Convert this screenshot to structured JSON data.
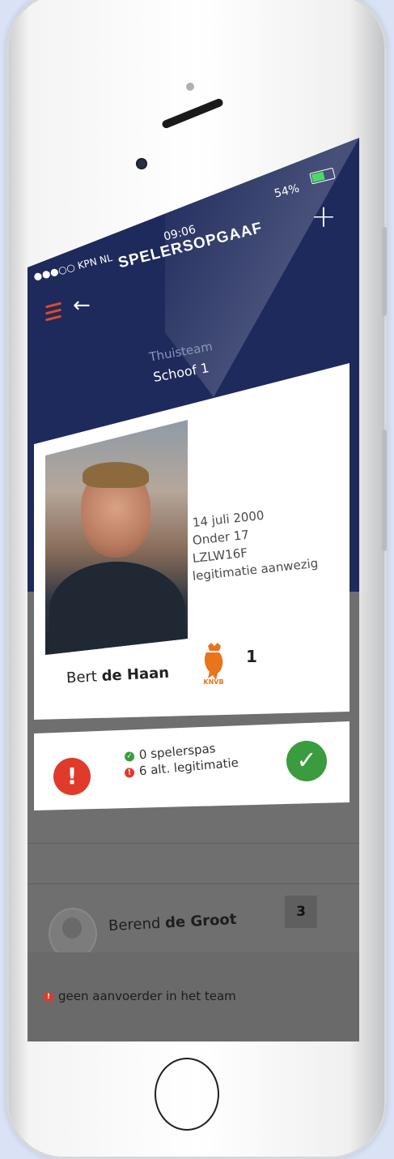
{
  "status_bar": {
    "carrier": "●●●○○ KPN NL",
    "time": "09:06",
    "battery": "54%"
  },
  "header": {
    "title": "SPELERSOPGAAF",
    "home_team_label": "Thuisteam",
    "home_team_name": "Schoof 1"
  },
  "player": {
    "first_name": "Bert",
    "last_name": "de Haan",
    "birth_date": "14 juli 2000",
    "age_group": "Onder 17",
    "code": "LZLW16F",
    "id_status": "legitimatie aanwezig",
    "shirt_number": "1",
    "logo_text": "KNVB"
  },
  "status_card": {
    "row1": "0 spelerspas",
    "row2": "6 alt. legitimatie",
    "alert_symbol": "!",
    "check_symbol": "✓"
  },
  "next_player": {
    "first_name": "Berend",
    "last_name": "de Groot",
    "shirt_number": "3"
  },
  "footer": {
    "message": "geen aanvoerder in het team"
  },
  "colors": {
    "header_blue": "#1e2a5c",
    "alert_red": "#e03a2b",
    "ok_green": "#3a9c3f",
    "menu_orange": "#e04a2a"
  }
}
